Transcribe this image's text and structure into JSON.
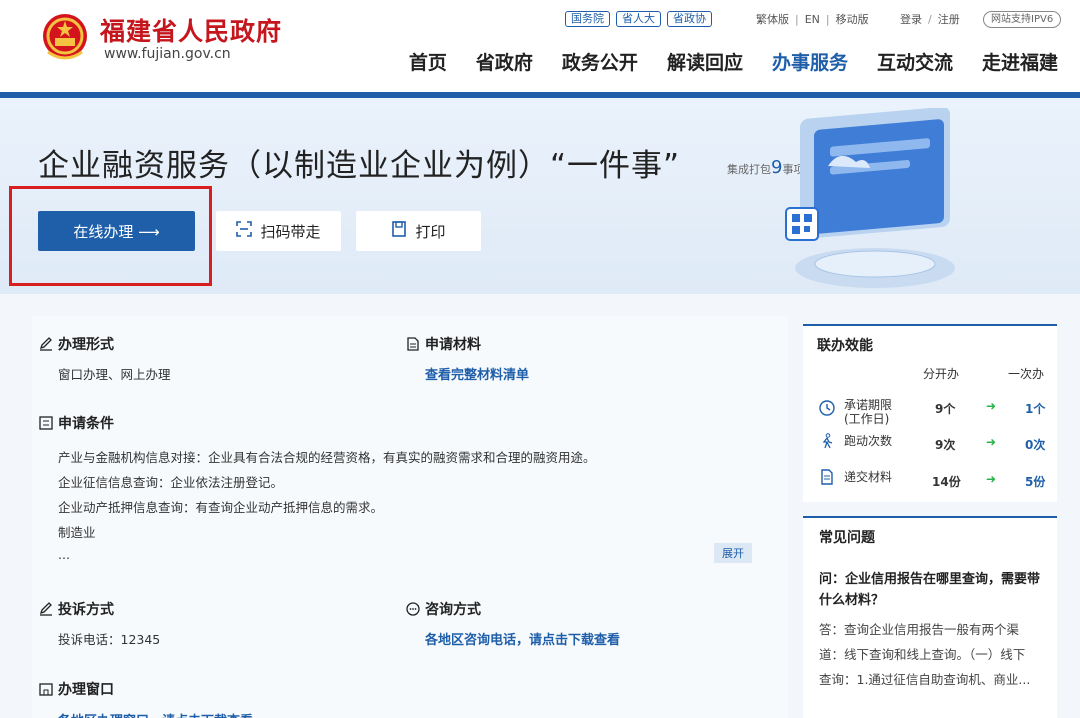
{
  "header": {
    "site_title": "福建省人民政府",
    "site_url": "www.fujian.gov.cn",
    "top_pills": [
      "国务院",
      "省人大",
      "省政协"
    ],
    "lang_links": [
      "繁体版",
      "EN",
      "移动版"
    ],
    "auth_links": [
      "登录",
      "注册"
    ],
    "ipv6_badge": "网站支持IPV6",
    "nav": [
      "首页",
      "省政府",
      "政务公开",
      "解读回应",
      "办事服务",
      "互动交流",
      "走进福建"
    ],
    "active_nav": "办事服务"
  },
  "banner": {
    "title": "企业融资服务（以制造业企业为例）“一件事”",
    "pack_prefix": "集成打包",
    "pack_count": "9",
    "pack_suffix": "事项",
    "btn_online": "在线办理 ⟶",
    "btn_scan": "扫码带走",
    "btn_print": "打印"
  },
  "content": {
    "mode_title": "办理形式",
    "mode_value": "窗口办理、网上办理",
    "materials_title": "申请材料",
    "materials_link": "查看完整材料清单",
    "conditions_title": "申请条件",
    "conditions": [
      "产业与金融机构信息对接：企业具有合法合规的经营资格，有真实的融资需求和合理的融资用途。",
      "企业征信信息查询：企业依法注册登记。",
      "企业动产抵押信息查询：有查询企业动产抵押信息的需求。",
      "制造业",
      "..."
    ],
    "expand": "展开",
    "complaint_title": "投诉方式",
    "complaint_value": "投诉电话：12345",
    "consult_title": "咨询方式",
    "consult_link": "各地区咨询电话，请点击下载查看",
    "window_title": "办理窗口",
    "window_link": "各地区办理窗口，请点击下载查看"
  },
  "efficiency": {
    "title": "联办效能",
    "col_separate": "分开办",
    "col_once": "一次办",
    "rows": [
      {
        "label": "承诺期限\n(工作日)",
        "separate": "9个",
        "once": "1个",
        "icon": "clock-icon"
      },
      {
        "label": "跑动次数",
        "separate": "9次",
        "once": "0次",
        "icon": "walk-icon"
      },
      {
        "label": "递交材料",
        "separate": "14份",
        "once": "5份",
        "icon": "document-icon"
      }
    ]
  },
  "faq": {
    "title": "常见问题",
    "question": "问：企业信用报告在哪里查询，需要带什么材料？",
    "answer_lines": [
      "答：查询企业信用报告一般有两个渠",
      "道：线下查询和线上查询。（一）线下",
      "查询：1.通过征信自助查询机、商业..."
    ]
  },
  "colors": {
    "primary": "#1f5faa",
    "brand_red": "#c4161c",
    "highlight_red": "#d81e1e",
    "green_arrow": "#29b24a"
  }
}
